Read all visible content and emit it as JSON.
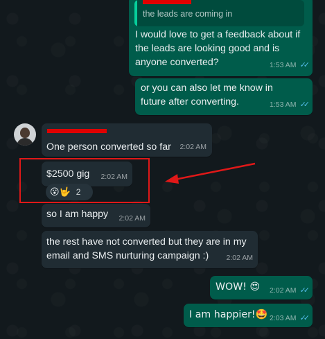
{
  "messages": {
    "feedback": {
      "quoted_text": "the leads are coming in",
      "text": "I would love to get a feedback about if the leads are looking good and is anyone converted?",
      "time": "1:53 AM"
    },
    "future": {
      "text": "or you can also let me know in future after converting.",
      "time": "1:53 AM"
    },
    "converted": {
      "text": "One person converted so far",
      "time": "2:02 AM"
    },
    "gig": {
      "text": "$2500 gig",
      "time": "2:02 AM",
      "reaction_emojis": "😮🤟",
      "reaction_count": "2"
    },
    "happy": {
      "text": "so I am happy",
      "time": "2:02 AM"
    },
    "rest": {
      "text": "the rest have not converted but they are in my email and SMS nurturing campaign :)",
      "time": "2:02 AM"
    },
    "wow": {
      "text": "WOW! 😍",
      "time": "2:02 AM"
    },
    "happier": {
      "text": "I am happier!🤩",
      "time": "2:03 AM"
    }
  },
  "icons": {
    "read_receipt": "double-check-icon",
    "annotation": "red-arrow-icon"
  },
  "colors": {
    "outgoing_bubble": "#005c4b",
    "incoming_bubble": "#202c33",
    "background": "#111b21",
    "read_tick": "#53bdeb",
    "annotation_red": "#e01818"
  }
}
